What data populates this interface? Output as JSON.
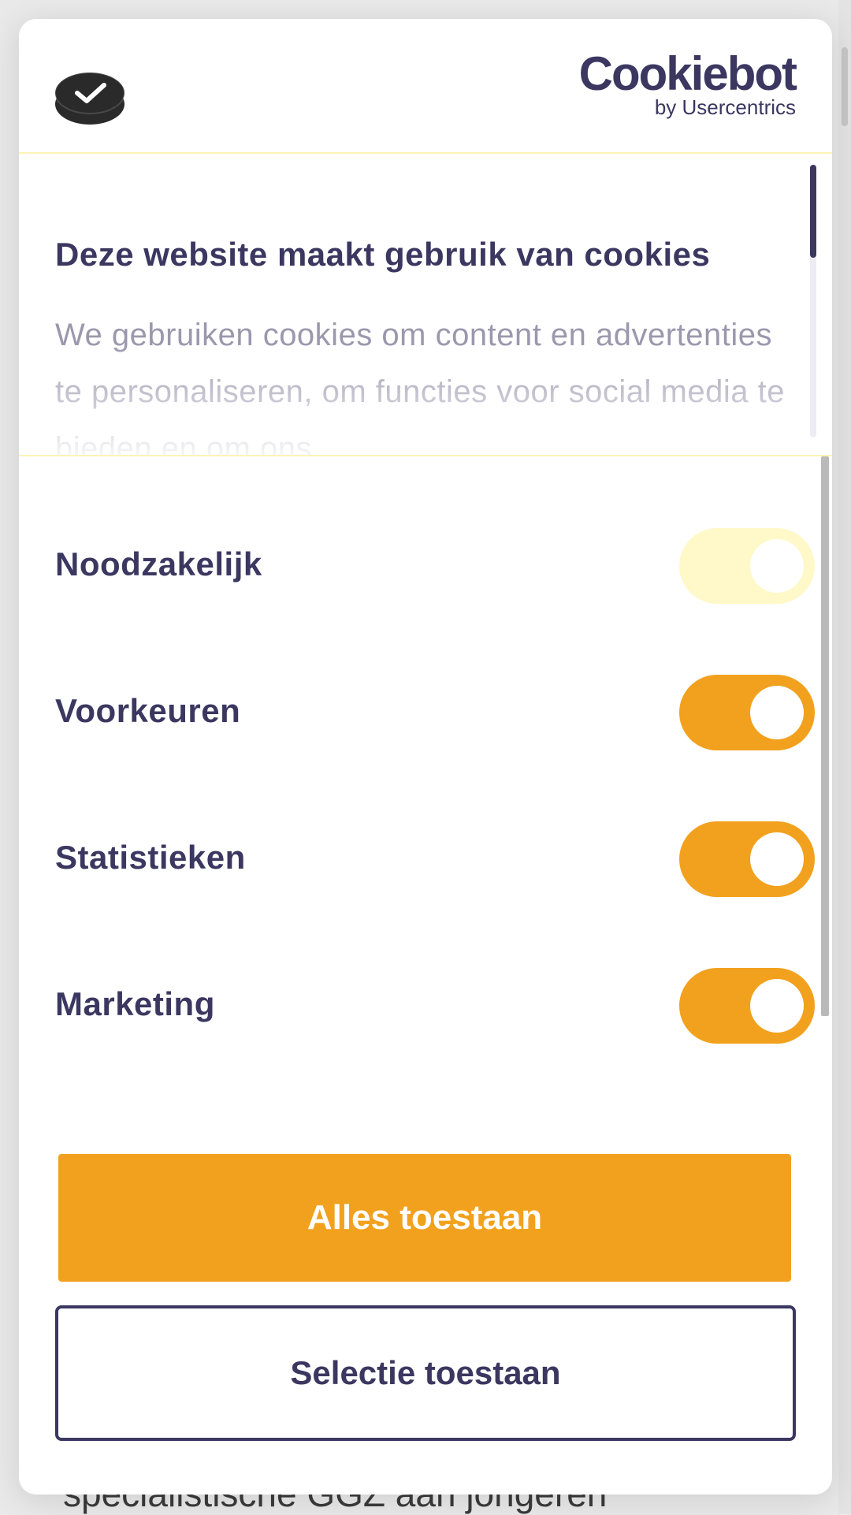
{
  "background": {
    "peek_text": "specialistische GGZ aan jongeren"
  },
  "header": {
    "brand_name": "Cookiebot",
    "brand_sub": "by Usercentrics",
    "logo_icon": "check-coin-icon"
  },
  "intro": {
    "title": "Deze website maakt gebruik van cookies",
    "text": "We gebruiken cookies om content en advertenties te personaliseren, om functies voor social media te bieden en om ons"
  },
  "toggles": [
    {
      "label": "Noodzakelijk",
      "checked": true,
      "disabled": true
    },
    {
      "label": "Voorkeuren",
      "checked": true,
      "disabled": false
    },
    {
      "label": "Statistieken",
      "checked": true,
      "disabled": false
    },
    {
      "label": "Marketing",
      "checked": true,
      "disabled": false
    }
  ],
  "buttons": {
    "allow_all": "Alles toestaan",
    "allow_selection": "Selectie toestaan"
  },
  "colors": {
    "brand_dark": "#3b3760",
    "accent": "#f2a11e",
    "disabled_toggle": "#fff8c9",
    "divider": "#fdf3b6"
  }
}
